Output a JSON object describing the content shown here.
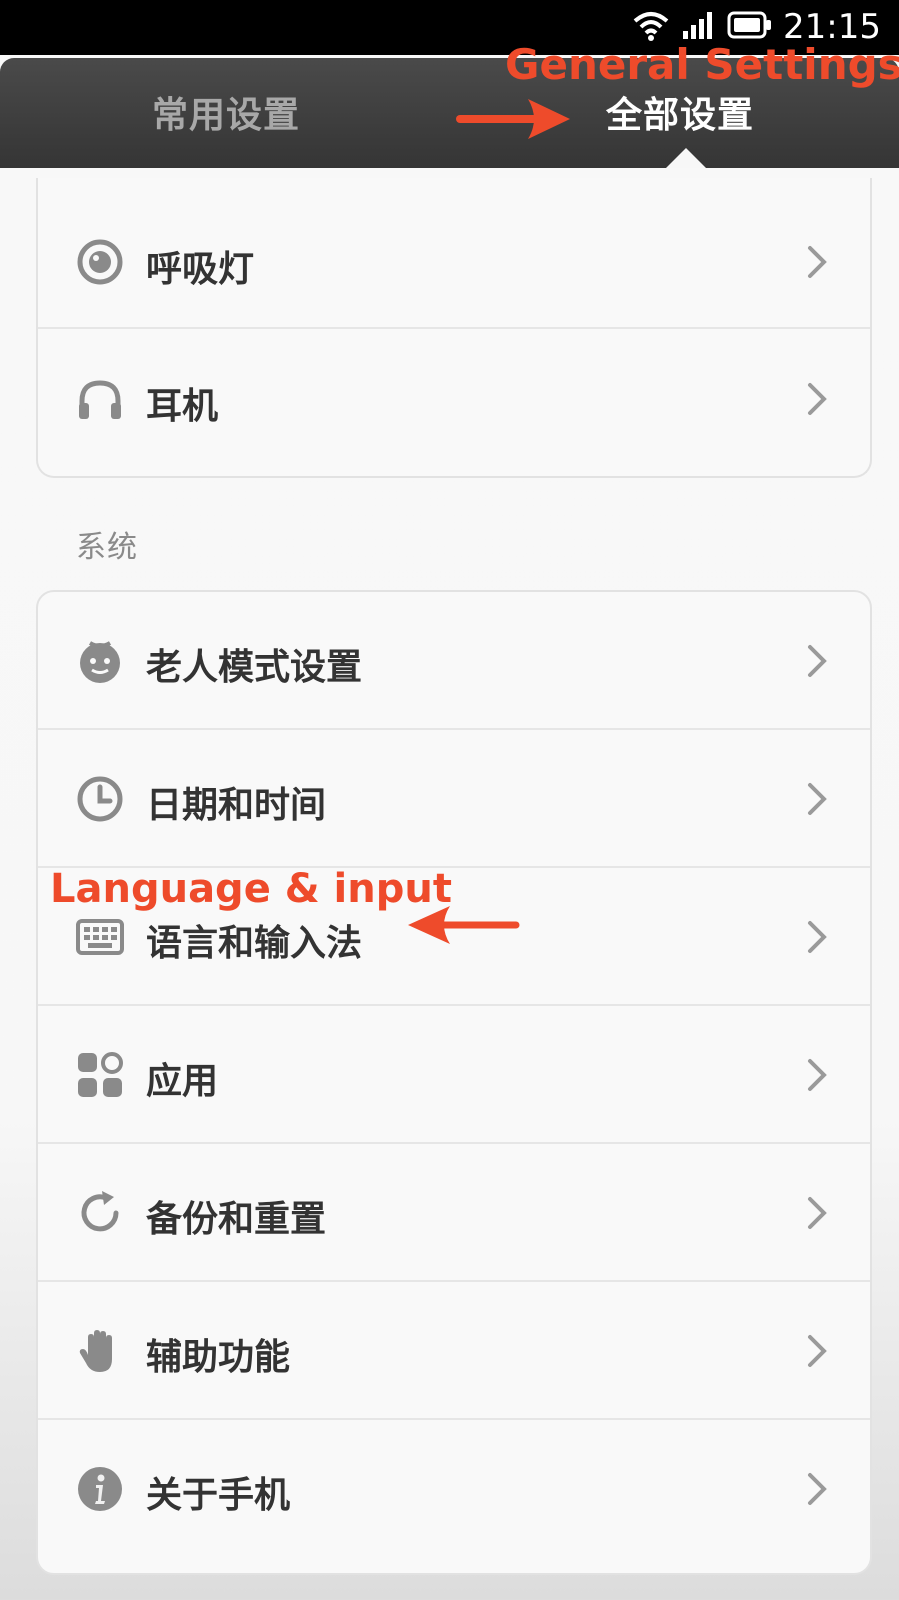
{
  "status_bar": {
    "time": "21:15"
  },
  "tabs": {
    "common_label": "常用设置",
    "all_label": "全部设置"
  },
  "annotations": {
    "general_settings": "General Settings",
    "language_input": "Language & input"
  },
  "top_group": {
    "items": [
      {
        "label": "呼吸灯",
        "icon": "breathing-light-icon"
      },
      {
        "label": "耳机",
        "icon": "headphones-icon"
      }
    ]
  },
  "system_section": {
    "title": "系统",
    "items": [
      {
        "label": "老人模式设置",
        "icon": "elderly-mode-icon"
      },
      {
        "label": "日期和时间",
        "icon": "clock-icon"
      },
      {
        "label": "语言和输入法",
        "icon": "keyboard-icon"
      },
      {
        "label": "应用",
        "icon": "apps-icon"
      },
      {
        "label": "备份和重置",
        "icon": "backup-reset-icon"
      },
      {
        "label": "辅助功能",
        "icon": "accessibility-hand-icon"
      },
      {
        "label": "关于手机",
        "icon": "info-icon"
      }
    ]
  },
  "colors": {
    "annotation": "#ee4b2b",
    "tab_bar": "#3f3f3f",
    "icon": "#8a8a8a",
    "text": "#333333"
  }
}
